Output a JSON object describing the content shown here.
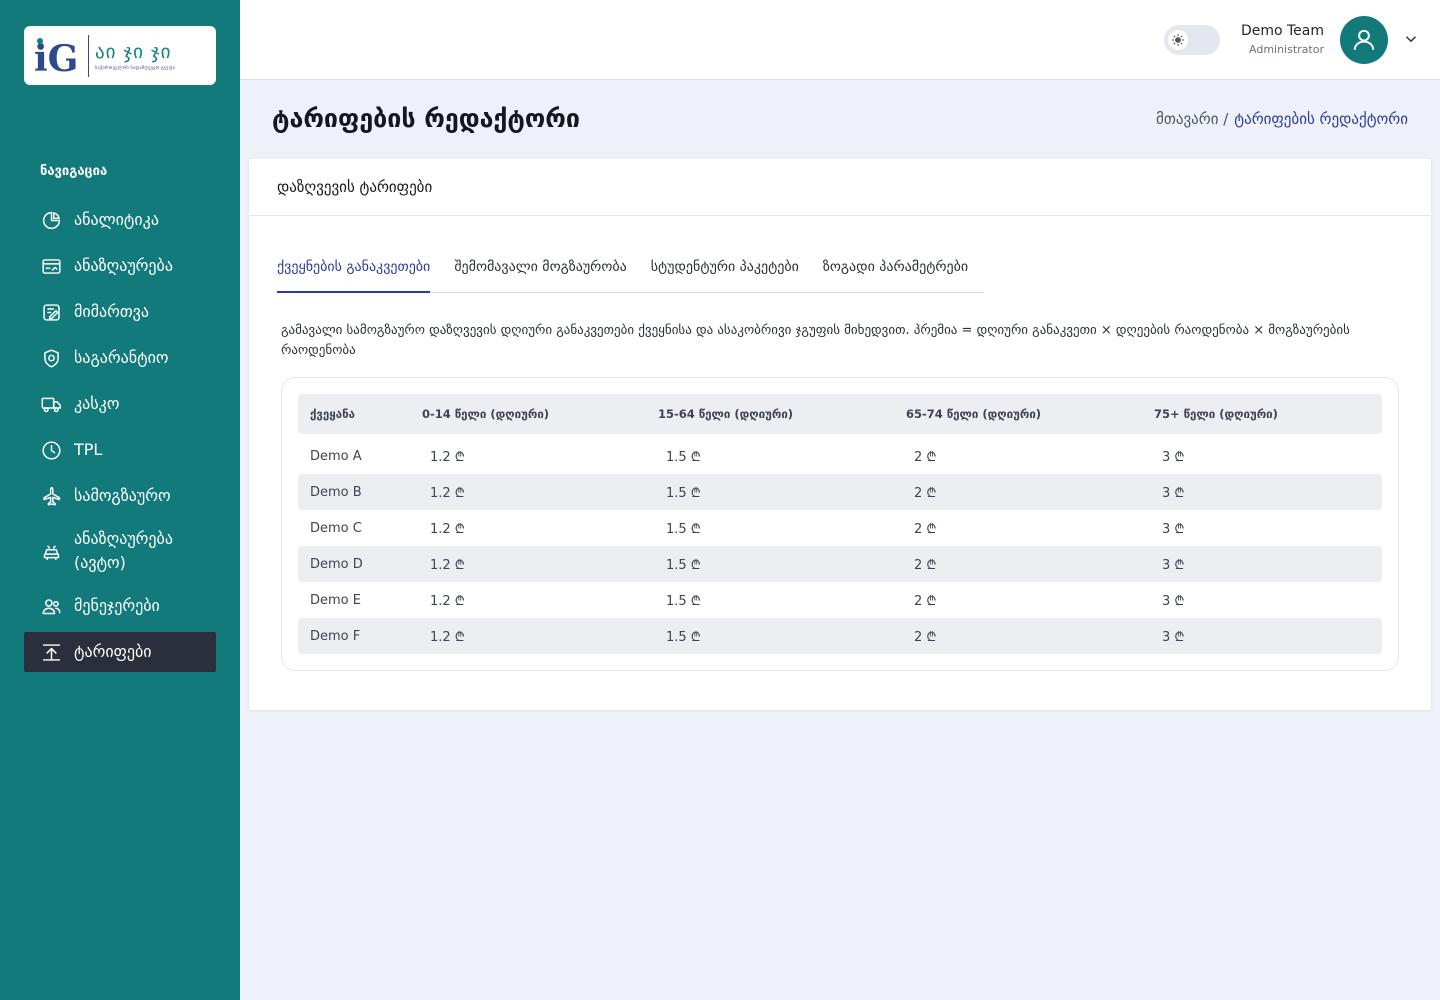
{
  "brand": {
    "mark": "iG",
    "title": "აი ჯი ჯი",
    "subtitle": "საქართველოს სადაზღვევო ჯგუფი"
  },
  "sidebar": {
    "header": "ნავიგაცია",
    "items": [
      {
        "label": "ანალიტიკა",
        "icon": "pie-chart-icon"
      },
      {
        "label": "ანაზღაურება",
        "icon": "payment-card-icon"
      },
      {
        "label": "მიმართვა",
        "icon": "edit-document-icon"
      },
      {
        "label": "საგარანტიო",
        "icon": "shield-icon"
      },
      {
        "label": "კასკო",
        "icon": "truck-icon"
      },
      {
        "label": "TPL",
        "icon": "clock-icon"
      },
      {
        "label": "სამოგზაურო",
        "icon": "airplane-icon"
      },
      {
        "label": "ანაზღაურება (ავტო)",
        "icon": "car-icon"
      },
      {
        "label": "მენეჯერები",
        "icon": "users-icon"
      },
      {
        "label": "ტარიფები",
        "icon": "upload-icon",
        "active": true
      }
    ]
  },
  "topbar": {
    "user_name": "Demo Team",
    "user_role": "Administrator"
  },
  "page": {
    "title": "ტარიფების რედაქტორი",
    "breadcrumb_home": "მთავარი /",
    "breadcrumb_current": "ტარიფების რედაქტორი"
  },
  "card": {
    "title": "დაზღვევის ტარიფები",
    "tabs": [
      {
        "label": "ქვეყნების განაკვეთები",
        "active": true
      },
      {
        "label": "შემომავალი მოგზაურობა"
      },
      {
        "label": "სტუდენტური პაკეტები"
      },
      {
        "label": "ზოგადი პარამეტრები"
      }
    ],
    "description": "გამავალი სამოგზაურო დაზღვევის დღიური განაკვეთები ქვეყნისა და ასაკობრივი ჯგუფის მიხედვით. პრემია = დღიური განაკვეთი × დღეების რაოდენობა × მოგზაურების რაოდენობა"
  },
  "table": {
    "headers": [
      "ქვეყანა",
      "0-14 წელი (დღიური)",
      "15-64 წელი (დღიური)",
      "65-74 წელი (დღიური)",
      "75+ წელი (დღიური)"
    ],
    "rows": [
      [
        "Demo A",
        "1.2 ₾",
        "1.5 ₾",
        "2 ₾",
        "3 ₾"
      ],
      [
        "Demo B",
        "1.2 ₾",
        "1.5 ₾",
        "2 ₾",
        "3 ₾"
      ],
      [
        "Demo C",
        "1.2 ₾",
        "1.5 ₾",
        "2 ₾",
        "3 ₾"
      ],
      [
        "Demo D",
        "1.2 ₾",
        "1.5 ₾",
        "2 ₾",
        "3 ₾"
      ],
      [
        "Demo E",
        "1.2 ₾",
        "1.5 ₾",
        "2 ₾",
        "3 ₾"
      ],
      [
        "Demo F",
        "1.2 ₾",
        "1.5 ₾",
        "2 ₾",
        "3 ₾"
      ]
    ]
  },
  "colors": {
    "sidebar_bg": "#137a7c",
    "active_item_bg": "#2b2f3c",
    "accent": "#2b3a9e",
    "page_bg": "#eef1f7"
  }
}
